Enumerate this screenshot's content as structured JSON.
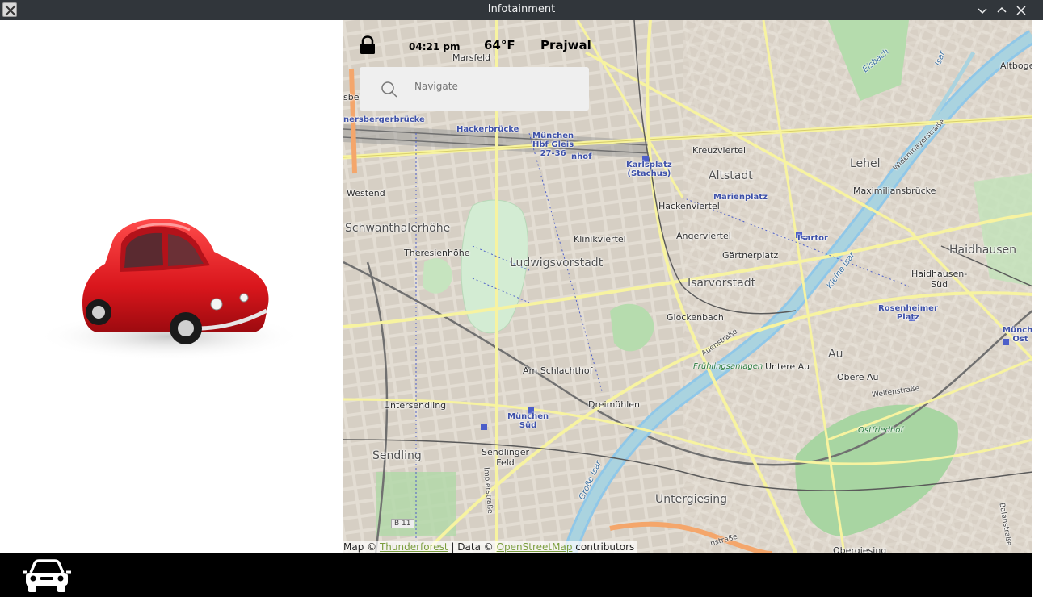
{
  "window": {
    "title": "Infotainment",
    "app_icon": "x-window-icon",
    "controls": [
      "minimize-icon",
      "maximize-icon",
      "close-icon"
    ]
  },
  "status": {
    "time": "04:21 pm",
    "temperature": "64°F",
    "user": "Prajwal",
    "lock_icon": "lock-icon"
  },
  "search": {
    "placeholder": "Navigate",
    "icon": "search-icon"
  },
  "map": {
    "labels": {
      "marsfeld": "Marsfeld",
      "hackerbruecke": "Hackerbrücke",
      "donnersberger": "nersbergerbrücke",
      "muenchen_hbf": "München\nHbf Gleis\n27-36",
      "hbf_suffix": "nhof",
      "karlsplatz": "Karlsplatz\n(Stachus)",
      "kreuzviertel": "Kreuzviertel",
      "altstadt": "Altstadt",
      "marienplatz": "Marienplatz",
      "lehel": "Lehel",
      "maximiliansbruecke": "Maximiliansbrücke",
      "westend": "Westend",
      "schwanthalerhoehe": "Schwanthalerhöhe",
      "theresienhoehe": "Theresienhöhe",
      "ludwigsvorstadt": "Ludwigsvorstadt",
      "klinikviertel": "Klinikviertel",
      "hackenviertel": "Hackenviertel",
      "angerviertel": "Angerviertel",
      "isartor": "Isartor",
      "gaertnerplatz": "Gärtnerplatz",
      "isarvorstadt": "Isarvorstadt",
      "haidhausen": "Haidhausen",
      "haidhausen_sued": "Haidhausen-\nSüd",
      "rosenheimer_platz": "Rosenheimer\nPlatz",
      "glockenbach": "Glockenbach",
      "auenstrasse": "Auenstraße",
      "fruehlingsanlagen": "Frühlingsanlagen",
      "am_schlachthof": "Am Schlachthof",
      "untere_au": "Untere Au",
      "au": "Au",
      "obere_au": "Obere Au",
      "welfenstrasse": "Welfenstraße",
      "ostfriedhof": "Ostfriedhof",
      "untersendling": "Untersendling",
      "dreimuehlen": "Dreimühlen",
      "muenchen_sued": "München\nSüd",
      "sendling": "Sendling",
      "sendlinger_feld": "Sendlinger\nFeld",
      "implerstrasse": "Implerstraße",
      "untergiesing": "Untergiesing",
      "b11": "B 11",
      "altbogenhausen": "Altbogenh",
      "eisbach": "Eisbach",
      "isar": "Isar",
      "widenmayerstrasse": "Widenmayerstraße",
      "muenchen_ost": "Münche\nOst",
      "obergiesing": "Obergiesing",
      "kleinhesseloher": "Kleine Isar",
      "grosse_isar": "Große Isar",
      "balanstrasse": "Balanstraße",
      "sber": "sber",
      "edge_strasse": "nstraße"
    },
    "attribution": {
      "prefix": "Map ©",
      "link1": "Thunderforest",
      "middle": "| Data ©",
      "link2": "OpenStreetMap",
      "suffix": "contributors"
    }
  },
  "bottom_bar": {
    "icon": "car-icon"
  },
  "colors": {
    "titlebar": "#31363b",
    "map_background": "#ece7de",
    "bottom_bar": "#000000",
    "car_red": "#d9161c"
  }
}
